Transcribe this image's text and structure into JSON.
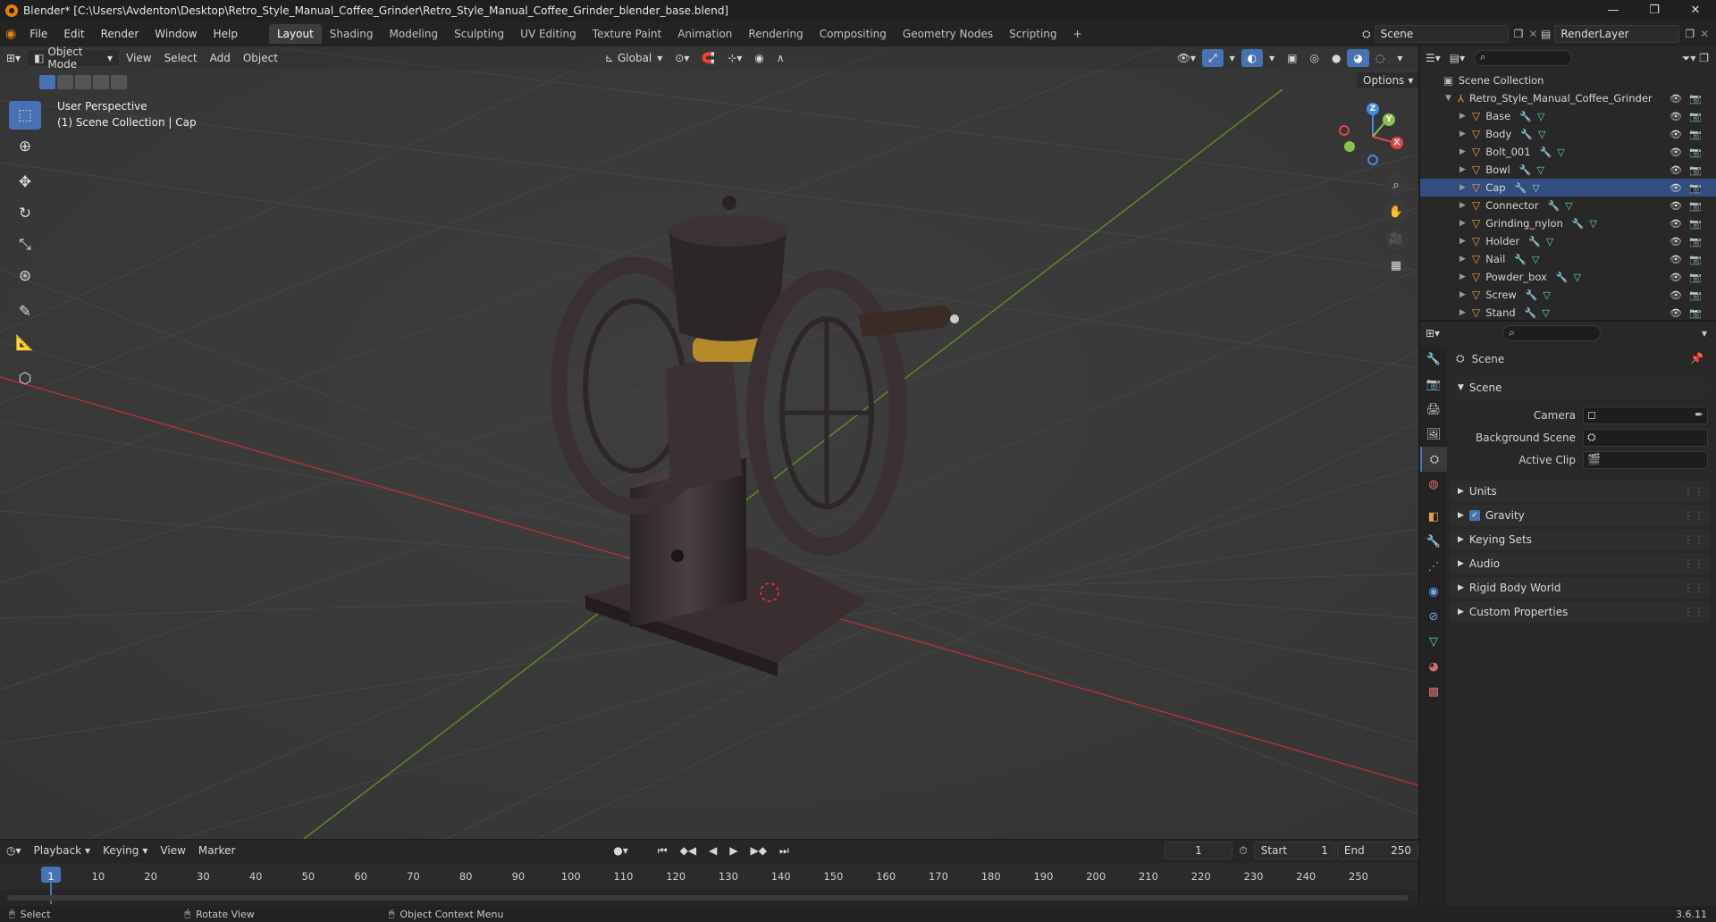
{
  "window": {
    "title": "Blender* [C:\\Users\\Avdenton\\Desktop\\Retro_Style_Manual_Coffee_Grinder\\Retro_Style_Manual_Coffee_Grinder_blender_base.blend]",
    "minimize": "—",
    "maximize": "❐",
    "close": "✕"
  },
  "menubar": {
    "menus": [
      "File",
      "Edit",
      "Render",
      "Window",
      "Help"
    ],
    "workspaces": [
      "Layout",
      "Shading",
      "Modeling",
      "Sculpting",
      "UV Editing",
      "Texture Paint",
      "Animation",
      "Rendering",
      "Compositing",
      "Geometry Nodes",
      "Scripting"
    ],
    "active_workspace": "Layout",
    "add_workspace": "+",
    "scene": "Scene",
    "view_layer": "RenderLayer"
  },
  "viewport": {
    "mode": "Object Mode",
    "menus": [
      "View",
      "Select",
      "Add",
      "Object"
    ],
    "orientation": "Global",
    "options": "Options",
    "overlay_line1": "User Perspective",
    "overlay_line2": "(1) Scene Collection | Cap",
    "gizmo_axes": [
      "Z",
      "Y",
      "X"
    ]
  },
  "outliner": {
    "root": "Scene Collection",
    "collection": "Retro_Style_Manual_Coffee_Grinder",
    "objects": [
      "Base",
      "Body",
      "Bolt_001",
      "Bowl",
      "Cap",
      "Connector",
      "Grinding_nylon",
      "Holder",
      "Nail",
      "Powder_box",
      "Screw",
      "Stand"
    ],
    "selected": "Cap"
  },
  "properties": {
    "context": "Scene",
    "panel_title": "Scene",
    "fields": [
      {
        "label": "Camera",
        "value": ""
      },
      {
        "label": "Background Scene",
        "value": ""
      },
      {
        "label": "Active Clip",
        "value": ""
      }
    ],
    "subpanels": [
      "Units",
      "Gravity",
      "Keying Sets",
      "Audio",
      "Rigid Body World",
      "Custom Properties"
    ],
    "gravity_checked": true
  },
  "timeline": {
    "menus": [
      "Playback",
      "Keying",
      "View",
      "Marker"
    ],
    "current_frame": "1",
    "start_label": "Start",
    "start": "1",
    "end_label": "End",
    "end": "250",
    "ruler": [
      "1",
      "10",
      "20",
      "30",
      "40",
      "50",
      "60",
      "70",
      "80",
      "90",
      "100",
      "110",
      "120",
      "130",
      "140",
      "150",
      "160",
      "170",
      "180",
      "190",
      "200",
      "210",
      "220",
      "230",
      "240",
      "250"
    ]
  },
  "statusbar": {
    "select": "Select",
    "rotate": "Rotate View",
    "context_menu": "Object Context Menu",
    "version": "3.6.11"
  },
  "colors": {
    "accent": "#4772b3",
    "x_axis": "#e0464b",
    "y_axis": "#8bc34a",
    "z_axis": "#3d8ee0",
    "object_icon": "#e8a040"
  }
}
